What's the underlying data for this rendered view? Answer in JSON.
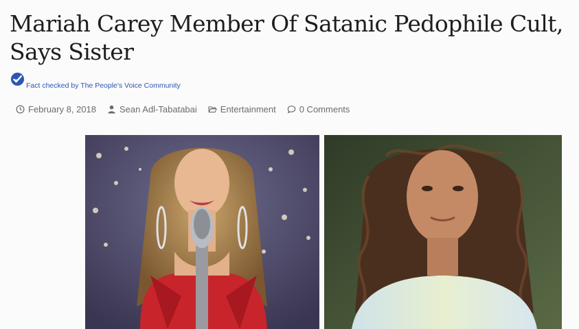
{
  "article": {
    "title": "Mariah Carey Member Of Satanic Pedophile Cult, Says Sister",
    "fact_check": {
      "icon": "checkmark-badge-icon",
      "text": "Fact checked by The People's Voice Community"
    },
    "meta": {
      "date": "February 8, 2018",
      "author": "Sean Adl-Tabatabai",
      "category": "Entertainment",
      "comments": "0 Comments"
    }
  },
  "colors": {
    "accent": "#2d55b3",
    "text": "#1e1e1e",
    "meta": "#6b6b6b"
  }
}
